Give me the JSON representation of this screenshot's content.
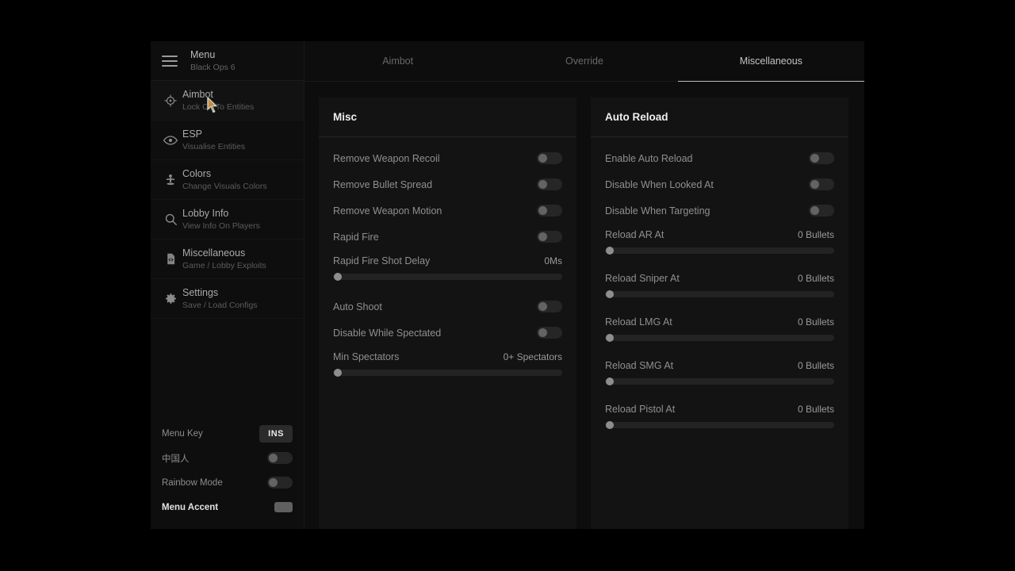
{
  "window": {
    "accent_color": "#2b3f63",
    "card_bg": "#131313",
    "sidebar_bg": "#0e0e0e"
  },
  "sidebar": {
    "menu_icon": "hamburger-icon",
    "title": "Menu",
    "subtitle": "Black Ops 6",
    "items": [
      {
        "icon": "crosshair-icon",
        "title": "Aimbot",
        "subtitle": "Lock On To Entities",
        "active": true
      },
      {
        "icon": "eye-icon",
        "title": "ESP",
        "subtitle": "Visualise Entities",
        "active": false
      },
      {
        "icon": "person-icon",
        "title": "Colors",
        "subtitle": "Change Visuals Colors",
        "active": false
      },
      {
        "icon": "search-icon",
        "title": "Lobby Info",
        "subtitle": "View Info On Players",
        "active": false
      },
      {
        "icon": "code-file-icon",
        "title": "Miscellaneous",
        "subtitle": "Game / Lobby Exploits",
        "active": false
      },
      {
        "icon": "gear-icon",
        "title": "Settings",
        "subtitle": "Save / Load Configs",
        "active": false
      }
    ],
    "bottom": {
      "menu_key_label": "Menu Key",
      "menu_key_value": "INS",
      "chinese_label": "中国人",
      "chinese_state": "off",
      "rainbow_label": "Rainbow Mode",
      "rainbow_state": "off",
      "accent_label": "Menu Accent",
      "accent_swatch": "#5f5f5f"
    }
  },
  "tabs": [
    {
      "label": "Aimbot",
      "active": false
    },
    {
      "label": "Override",
      "active": false
    },
    {
      "label": "Miscellaneous",
      "active": true
    }
  ],
  "panels": [
    {
      "title": "Misc",
      "rows": [
        {
          "kind": "toggle",
          "label": "Remove Weapon Recoil",
          "state": "off"
        },
        {
          "kind": "toggle",
          "label": "Remove Bullet Spread",
          "state": "off"
        },
        {
          "kind": "toggle",
          "label": "Remove Weapon Motion",
          "state": "off"
        },
        {
          "kind": "toggle",
          "label": "Rapid Fire",
          "state": "off"
        },
        {
          "kind": "slider",
          "label": "Rapid Fire Shot Delay",
          "value": "0Ms",
          "percent": 0
        },
        {
          "kind": "toggle",
          "label": "Auto Shoot",
          "state": "off"
        },
        {
          "kind": "toggle",
          "label": "Disable While Spectated",
          "state": "off"
        },
        {
          "kind": "slider",
          "label": "Min Spectators",
          "value": "0+ Spectators",
          "percent": 0
        }
      ]
    },
    {
      "title": "Auto Reload",
      "rows": [
        {
          "kind": "toggle",
          "label": "Enable Auto Reload",
          "state": "off"
        },
        {
          "kind": "toggle",
          "label": "Disable When Looked At",
          "state": "off"
        },
        {
          "kind": "toggle",
          "label": "Disable When Targeting",
          "state": "off"
        },
        {
          "kind": "slider",
          "label": "Reload AR At",
          "value": "0 Bullets",
          "percent": 0
        },
        {
          "kind": "slider",
          "label": "Reload Sniper At",
          "value": "0 Bullets",
          "percent": 0
        },
        {
          "kind": "slider",
          "label": "Reload LMG At",
          "value": "0 Bullets",
          "percent": 0
        },
        {
          "kind": "slider",
          "label": "Reload SMG At",
          "value": "0 Bullets",
          "percent": 0
        },
        {
          "kind": "slider",
          "label": "Reload Pistol At",
          "value": "0 Bullets",
          "percent": 0
        }
      ]
    }
  ]
}
